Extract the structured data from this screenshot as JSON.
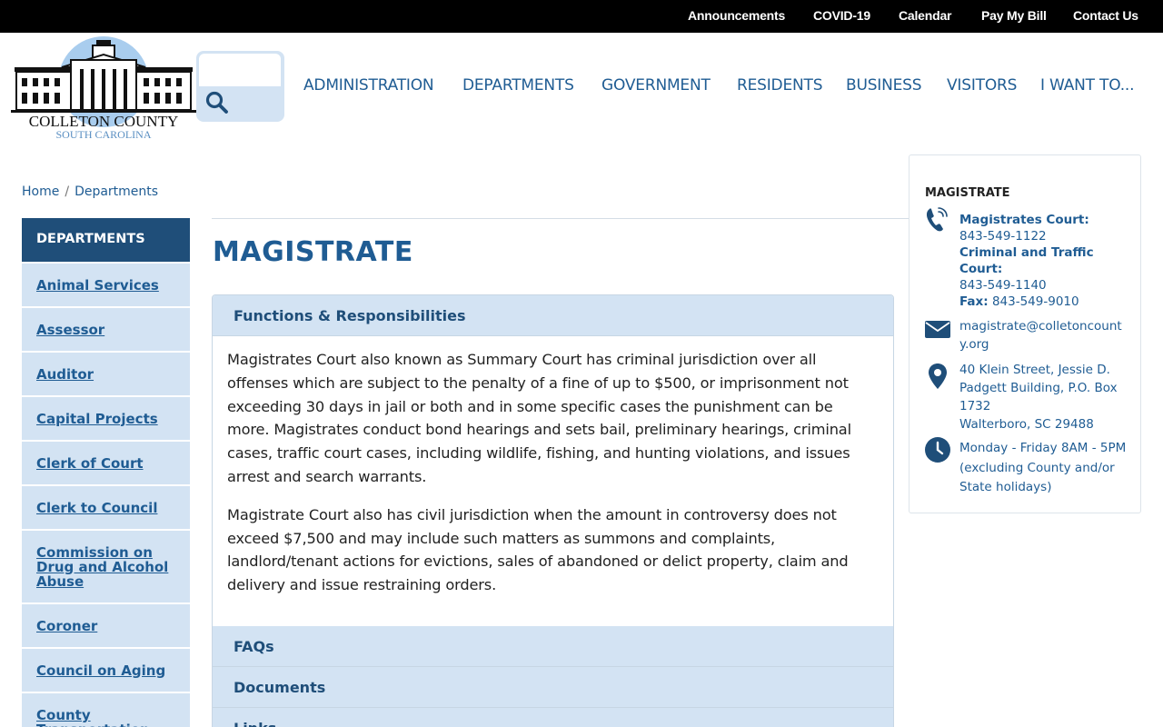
{
  "topbar": {
    "links": [
      "Announcements",
      "COVID-19",
      "Calendar",
      "Pay My Bill",
      "Contact Us"
    ]
  },
  "logo": {
    "name": "COLLETON COUNTY",
    "state": "SOUTH CAROLINA"
  },
  "search": {
    "placeholder": ""
  },
  "nav": {
    "items": [
      "ADMINISTRATION",
      "DEPARTMENTS",
      "GOVERNMENT",
      "RESIDENTS",
      "BUSINESS",
      "VISITORS",
      "I WANT TO..."
    ]
  },
  "breadcrumb": {
    "home": "Home",
    "separator": "/",
    "current": "Departments"
  },
  "sidebar": {
    "heading": "DEPARTMENTS",
    "items": [
      "Animal Services",
      "Assessor",
      "Auditor",
      "Capital Projects",
      "Clerk of Court",
      "Clerk to Council",
      "Commission on Drug and Alcohol Abuse",
      "Coroner",
      "Council on Aging",
      "County Transportation"
    ]
  },
  "main": {
    "title": "MAGISTRATE",
    "sections": [
      {
        "title": "Functions & Responsibilities",
        "paragraphs": [
          "Magistrates Court also known as Summary Court has criminal jurisdiction over all offenses which are subject to the penalty of a fine of up to $500, or imprisonment not exceeding 30 days in jail or both and in some specific cases the punishment can be more. Magistrates conduct bond hearings and sets bail, preliminary hearings, criminal cases, traffic court cases, including wildlife, fishing, and hunting violations, and issues arrest and search warrants.",
          "Magistrate Court also has civil jurisdiction when the amount in controversy does not exceed $7,500 and may include such matters as summons and complaints, landlord/tenant actions for evictions, sales of abandoned or delict property, claim and delivery and issue restraining orders."
        ]
      },
      {
        "title": "FAQs"
      },
      {
        "title": "Documents"
      },
      {
        "title": "Links"
      }
    ]
  },
  "info": {
    "title": "MAGISTRATE",
    "phone": {
      "court_label": "Magistrates Court:",
      "court_number": "843-549-1122",
      "traffic_label": "Criminal and Traffic Court:",
      "traffic_number": "843-549-1140",
      "fax_label": "Fax:",
      "fax_number": "843-549-9010"
    },
    "email": "magistrate@colletoncounty.org",
    "address": [
      "40 Klein Street, Jessie D. Padgett Building, P.O. Box 1732",
      "Walterboro, SC 29488"
    ],
    "hours": "Monday - Friday 8AM - 5PM (excluding County and/or State holidays)"
  },
  "colors": {
    "brand_blue": "#1f5c93",
    "dark_blue": "#1f4e79",
    "light_blue": "#d3e3f3",
    "topbar": "#000000"
  },
  "icons": [
    "search-icon",
    "phone-icon",
    "envelope-icon",
    "map-pin-icon",
    "clock-icon"
  ]
}
